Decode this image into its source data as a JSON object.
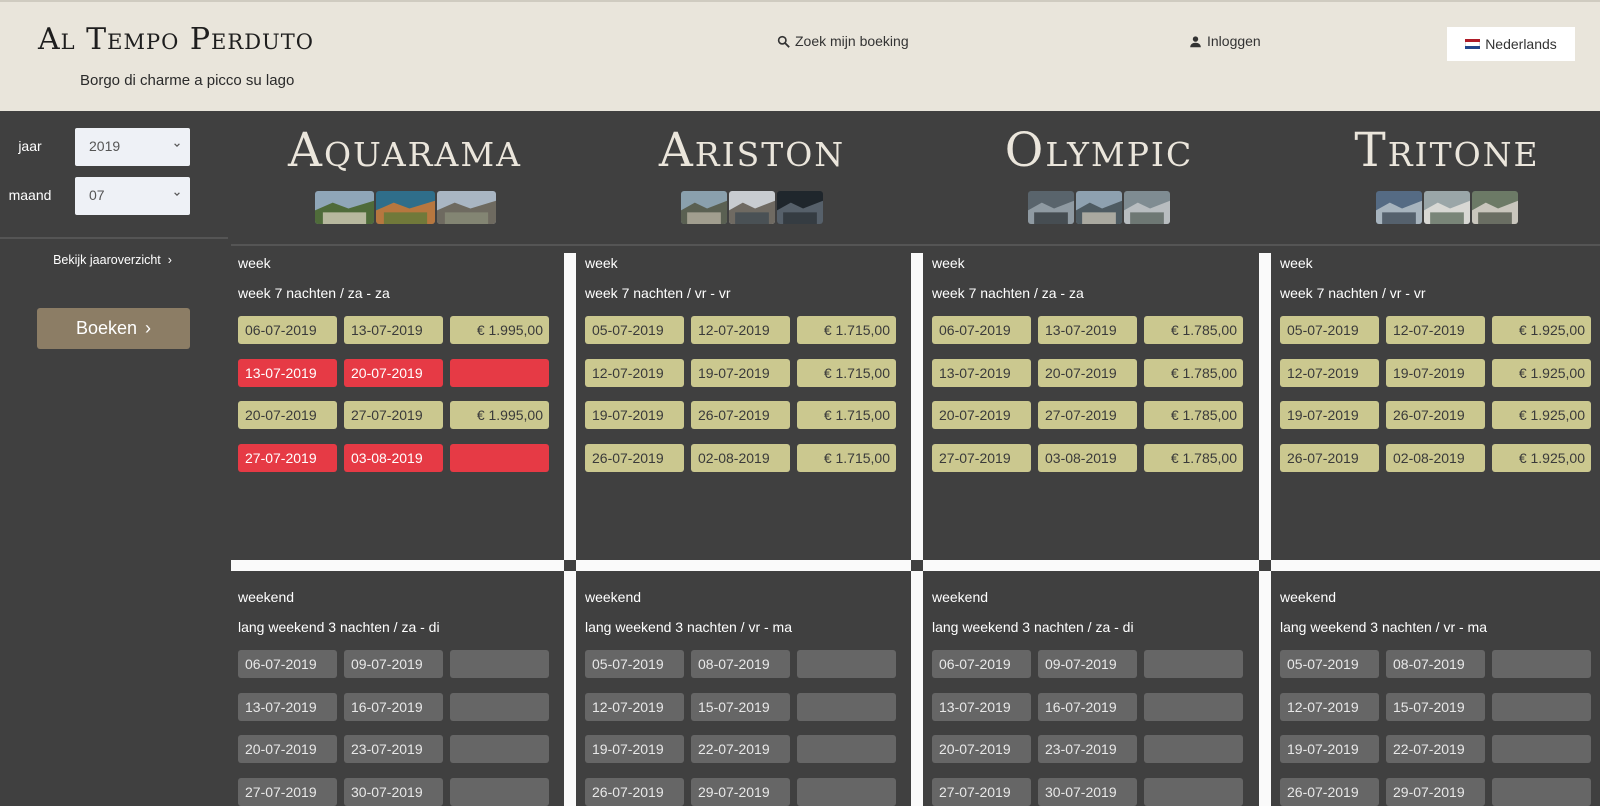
{
  "header": {
    "brand_title": "Al Tempo Perduto",
    "brand_subtitle": "Borgo di charme a picco su lago",
    "search_label": "Zoek mijn boeking",
    "login_label": "Inloggen",
    "language_label": "Nederlands"
  },
  "sidebar": {
    "year_label": "jaar",
    "year_value": "2019",
    "month_label": "maand",
    "month_value": "07",
    "year_overview_label": "Bekijk jaaroverzicht",
    "book_button_label": "Boeken"
  },
  "colors": {
    "header_bg": "#e9e5db",
    "page_bg": "#404040",
    "available": "#cbc88f",
    "booked": "#e63a45",
    "unavailable": "#666666",
    "book_button": "#8c7d65"
  },
  "accommodations": [
    {
      "name": "Aquarama",
      "photo_count": 3,
      "week": {
        "title": "week",
        "subtitle": "week 7 nachten / za - za",
        "rows": [
          {
            "from": "06-07-2019",
            "to": "13-07-2019",
            "price": "€ 1.995,00",
            "status": "available"
          },
          {
            "from": "13-07-2019",
            "to": "20-07-2019",
            "price": "",
            "status": "booked"
          },
          {
            "from": "20-07-2019",
            "to": "27-07-2019",
            "price": "€ 1.995,00",
            "status": "available"
          },
          {
            "from": "27-07-2019",
            "to": "03-08-2019",
            "price": "",
            "status": "booked"
          }
        ]
      },
      "weekend": {
        "title": "weekend",
        "subtitle": "lang weekend 3 nachten / za - di",
        "rows": [
          {
            "from": "06-07-2019",
            "to": "09-07-2019",
            "price": "",
            "status": "unavailable"
          },
          {
            "from": "13-07-2019",
            "to": "16-07-2019",
            "price": "",
            "status": "unavailable"
          },
          {
            "from": "20-07-2019",
            "to": "23-07-2019",
            "price": "",
            "status": "unavailable"
          },
          {
            "from": "27-07-2019",
            "to": "30-07-2019",
            "price": "",
            "status": "unavailable"
          }
        ]
      }
    },
    {
      "name": "Ariston",
      "photo_count": 3,
      "week": {
        "title": "week",
        "subtitle": "week 7 nachten / vr - vr",
        "rows": [
          {
            "from": "05-07-2019",
            "to": "12-07-2019",
            "price": "€ 1.715,00",
            "status": "available"
          },
          {
            "from": "12-07-2019",
            "to": "19-07-2019",
            "price": "€ 1.715,00",
            "status": "available"
          },
          {
            "from": "19-07-2019",
            "to": "26-07-2019",
            "price": "€ 1.715,00",
            "status": "available"
          },
          {
            "from": "26-07-2019",
            "to": "02-08-2019",
            "price": "€ 1.715,00",
            "status": "available"
          }
        ]
      },
      "weekend": {
        "title": "weekend",
        "subtitle": "lang weekend 3 nachten / vr - ma",
        "rows": [
          {
            "from": "05-07-2019",
            "to": "08-07-2019",
            "price": "",
            "status": "unavailable"
          },
          {
            "from": "12-07-2019",
            "to": "15-07-2019",
            "price": "",
            "status": "unavailable"
          },
          {
            "from": "19-07-2019",
            "to": "22-07-2019",
            "price": "",
            "status": "unavailable"
          },
          {
            "from": "26-07-2019",
            "to": "29-07-2019",
            "price": "",
            "status": "unavailable"
          }
        ]
      }
    },
    {
      "name": "Olympic",
      "photo_count": 3,
      "week": {
        "title": "week",
        "subtitle": "week 7 nachten / za - za",
        "rows": [
          {
            "from": "06-07-2019",
            "to": "13-07-2019",
            "price": "€ 1.785,00",
            "status": "available"
          },
          {
            "from": "13-07-2019",
            "to": "20-07-2019",
            "price": "€ 1.785,00",
            "status": "available"
          },
          {
            "from": "20-07-2019",
            "to": "27-07-2019",
            "price": "€ 1.785,00",
            "status": "available"
          },
          {
            "from": "27-07-2019",
            "to": "03-08-2019",
            "price": "€ 1.785,00",
            "status": "available"
          }
        ]
      },
      "weekend": {
        "title": "weekend",
        "subtitle": "lang weekend 3 nachten / za - di",
        "rows": [
          {
            "from": "06-07-2019",
            "to": "09-07-2019",
            "price": "",
            "status": "unavailable"
          },
          {
            "from": "13-07-2019",
            "to": "16-07-2019",
            "price": "",
            "status": "unavailable"
          },
          {
            "from": "20-07-2019",
            "to": "23-07-2019",
            "price": "",
            "status": "unavailable"
          },
          {
            "from": "27-07-2019",
            "to": "30-07-2019",
            "price": "",
            "status": "unavailable"
          }
        ]
      }
    },
    {
      "name": "Tritone",
      "photo_count": 3,
      "week": {
        "title": "week",
        "subtitle": "week 7 nachten / vr - vr",
        "rows": [
          {
            "from": "05-07-2019",
            "to": "12-07-2019",
            "price": "€ 1.925,00",
            "status": "available"
          },
          {
            "from": "12-07-2019",
            "to": "19-07-2019",
            "price": "€ 1.925,00",
            "status": "available"
          },
          {
            "from": "19-07-2019",
            "to": "26-07-2019",
            "price": "€ 1.925,00",
            "status": "available"
          },
          {
            "from": "26-07-2019",
            "to": "02-08-2019",
            "price": "€ 1.925,00",
            "status": "available"
          }
        ]
      },
      "weekend": {
        "title": "weekend",
        "subtitle": "lang weekend 3 nachten / vr - ma",
        "rows": [
          {
            "from": "05-07-2019",
            "to": "08-07-2019",
            "price": "",
            "status": "unavailable"
          },
          {
            "from": "12-07-2019",
            "to": "15-07-2019",
            "price": "",
            "status": "unavailable"
          },
          {
            "from": "19-07-2019",
            "to": "22-07-2019",
            "price": "",
            "status": "unavailable"
          },
          {
            "from": "26-07-2019",
            "to": "29-07-2019",
            "price": "",
            "status": "unavailable"
          }
        ]
      }
    }
  ]
}
